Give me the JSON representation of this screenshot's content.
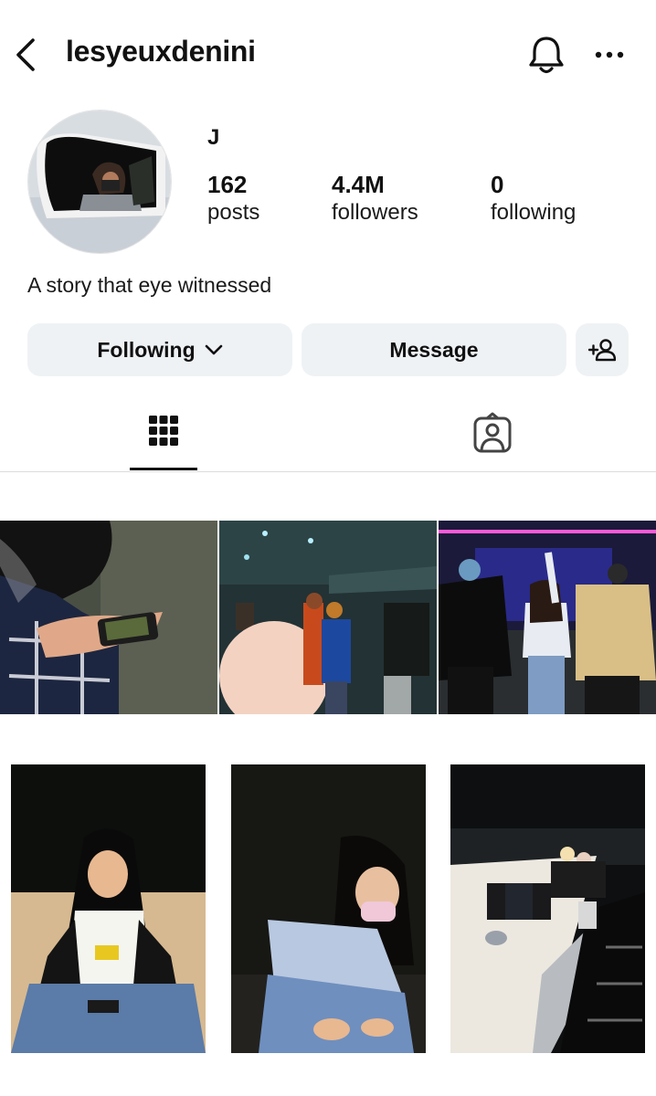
{
  "header": {
    "username": "lesyeuxdenini",
    "back_icon": "chevron-left-icon",
    "bell_icon": "bell-icon",
    "more_icon": "more-horizontal-icon"
  },
  "profile": {
    "display_name": "J",
    "stats": [
      {
        "value": "162",
        "label": "posts"
      },
      {
        "value": "4.4M",
        "label": "followers"
      },
      {
        "value": "0",
        "label": "following"
      }
    ],
    "bio": "A story that eye witnessed"
  },
  "actions": {
    "following_label": "Following",
    "message_label": "Message",
    "add_icon": "add-person-icon"
  },
  "tabs": [
    {
      "icon": "grid-icon",
      "active": true
    },
    {
      "icon": "tagged-person-icon",
      "active": false
    }
  ],
  "colors": {
    "button_bg": "#eff2f5",
    "text": "#111111",
    "divider": "#dcdcdc"
  }
}
